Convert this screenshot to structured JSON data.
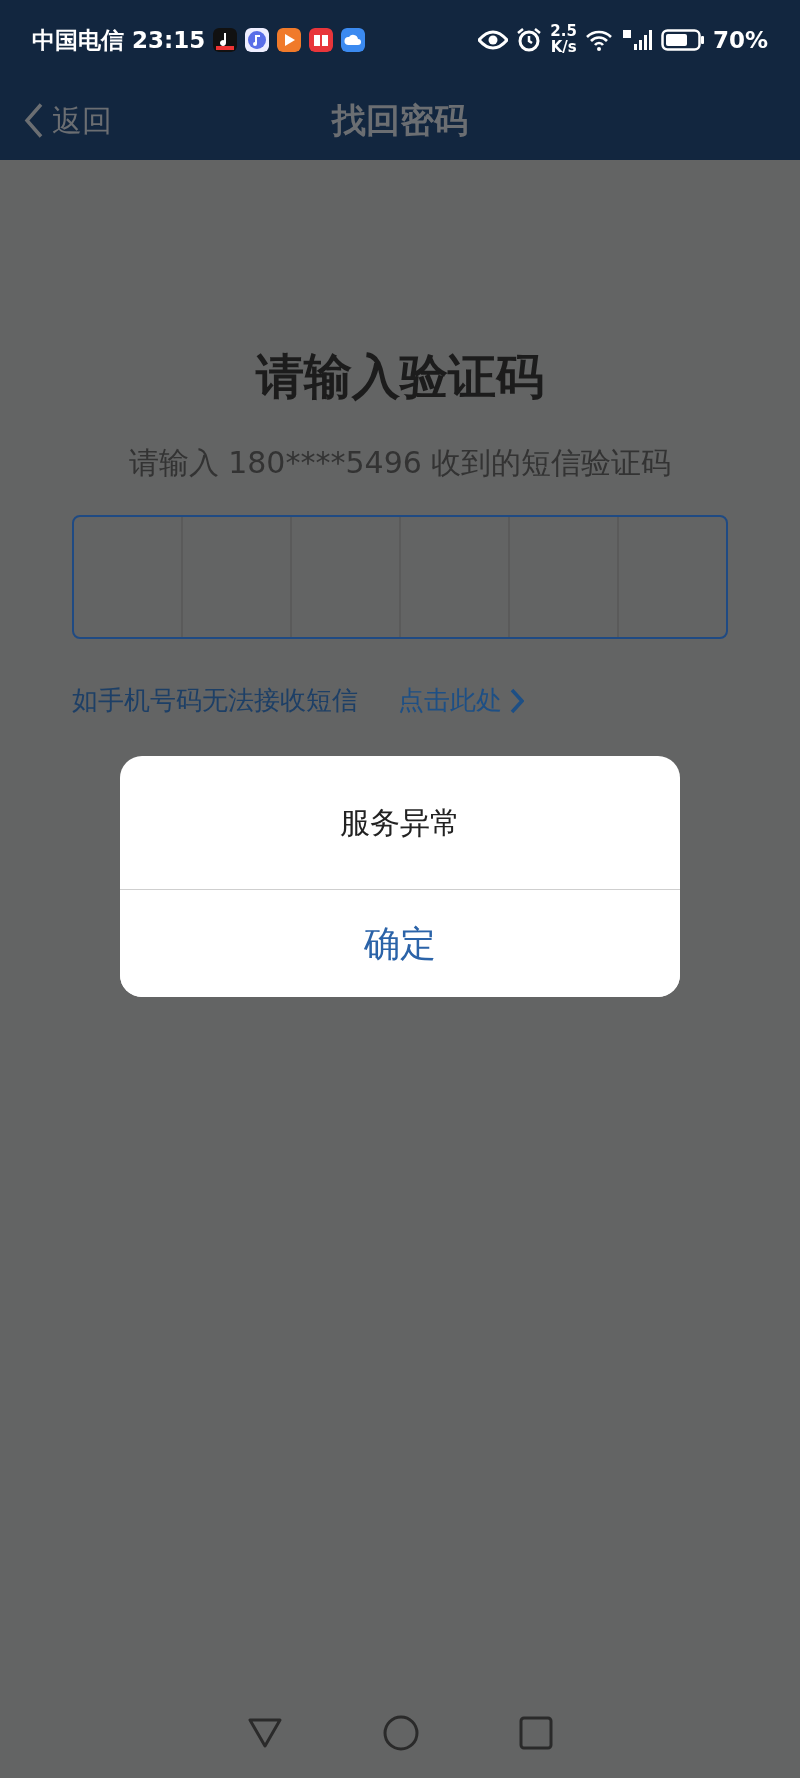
{
  "status_bar": {
    "carrier": "中国电信",
    "time": "23:15",
    "speed_value": "2.5",
    "speed_unit": "K/s",
    "battery": "70%"
  },
  "header": {
    "back": "返回",
    "title": "找回密码"
  },
  "title": "请输入验证码",
  "subtitle": "请输入 180****5496 收到的短信验证码",
  "code_cells": [
    {
      "filled": false
    },
    {
      "filled": false
    },
    {
      "filled": false
    },
    {
      "filled": false
    },
    {
      "filled": false
    },
    {
      "filled": false
    }
  ],
  "help": {
    "text": "如手机号码无法接收短信",
    "link": "点击此处"
  },
  "dialog": {
    "message": "服务异常",
    "button": "确定"
  }
}
